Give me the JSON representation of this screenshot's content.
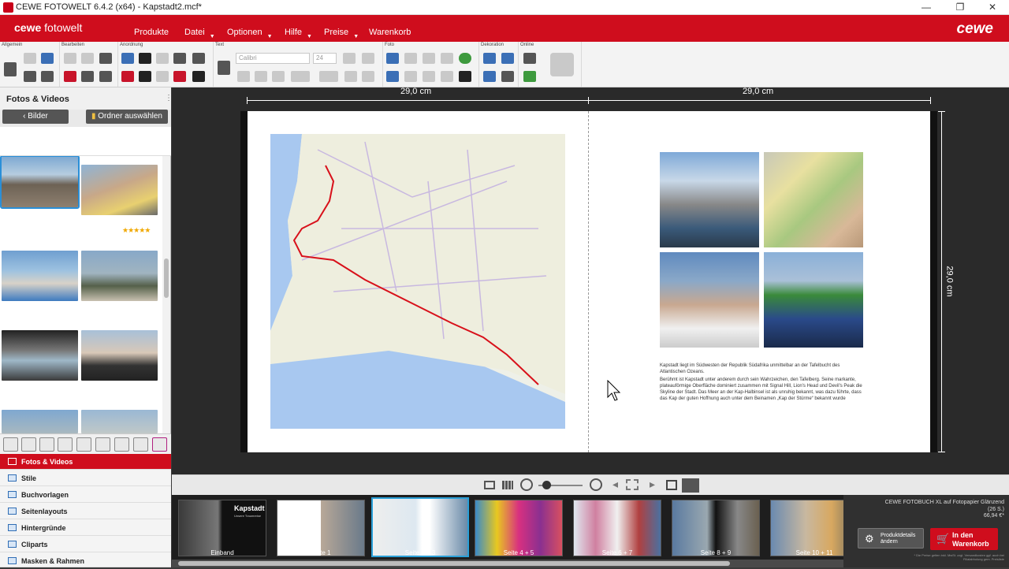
{
  "window": {
    "title": "CEWE FOTOWELT 6.4.2 (x64) - Kapstadt2.mcf*",
    "minimize": "—",
    "maximize": "❐",
    "close": "✕"
  },
  "menubar": {
    "brand_bold": "cewe",
    "brand_light": "fotowelt",
    "logo": "cewe",
    "items": [
      {
        "label": "Produkte"
      },
      {
        "label": "Datei"
      },
      {
        "label": "Optionen"
      },
      {
        "label": "Hilfe"
      },
      {
        "label": "Preise"
      },
      {
        "label": "Warenkorb"
      }
    ],
    "accent_color": "#cf0d1d"
  },
  "ribbon": {
    "groups": [
      {
        "label": "Allgemein"
      },
      {
        "label": "Bearbeiten"
      },
      {
        "label": "Anordnung"
      },
      {
        "label": "Text"
      },
      {
        "label": "Foto"
      },
      {
        "label": "Dekoration"
      },
      {
        "label": "Online"
      }
    ],
    "font": "Calibri",
    "font_size": "24"
  },
  "left_panel": {
    "title": "Fotos & Videos",
    "back_button": "Bilder",
    "folder_button": "Ordner auswählen",
    "rating": "★★★★★",
    "nav": [
      {
        "label": "Fotos & Videos"
      },
      {
        "label": "Stile"
      },
      {
        "label": "Buchvorlagen"
      },
      {
        "label": "Seitenlayouts"
      },
      {
        "label": "Hintergründe"
      },
      {
        "label": "Cliparts"
      },
      {
        "label": "Masken & Rahmen"
      }
    ]
  },
  "workspace": {
    "dim_left": "29,0 cm",
    "dim_right": "29,0 cm",
    "dim_height": "29,0 cm",
    "text_p1": "Kapstadt liegt im Südwesten der Republik Südafrika unmittelbar an der Tafelbucht des Atlantischen Ozeans.",
    "text_p2": "Berühmt ist Kapstadt unter anderem durch sein Wahrzeichen, den Tafelberg. Seine markante, plateauförmige Oberfläche dominiert zusammen mit Signal Hill, Lion's Head und Devil's Peak die Skyline der Stadt. Das Meer an der Kap-Halbinsel ist als unruhig bekannt, was dazu führte, dass das Kap der guten Hoffnung auch unter dem Beinamen „Kap der Stürme“ bekannt wurde"
  },
  "filmstrip": {
    "pages": [
      {
        "label": "Einband",
        "cover_title": "Kapstadt",
        "cover_sub": "Unsere Traumreise"
      },
      {
        "label": "Seite 1"
      },
      {
        "label": "Seite 2 + 3"
      },
      {
        "label": "Seite 4 + 5"
      },
      {
        "label": "Seite 6 + 7"
      },
      {
        "label": "Seite 8 + 9"
      },
      {
        "label": "Seite 10 + 11"
      }
    ]
  },
  "order": {
    "product": "CEWE FOTOBUCH XL auf Fotopapier Glänzend",
    "pages": "(26 S.)",
    "price": "66,94 €*",
    "details_button": "Produktdetails ändern",
    "cart_button": "In den Warenkorb",
    "note": "* Die Preise gelten inkl. MwSt. zzgl. Versandkosten ggf. auch bei Filialabholung gem. Preisliste"
  }
}
